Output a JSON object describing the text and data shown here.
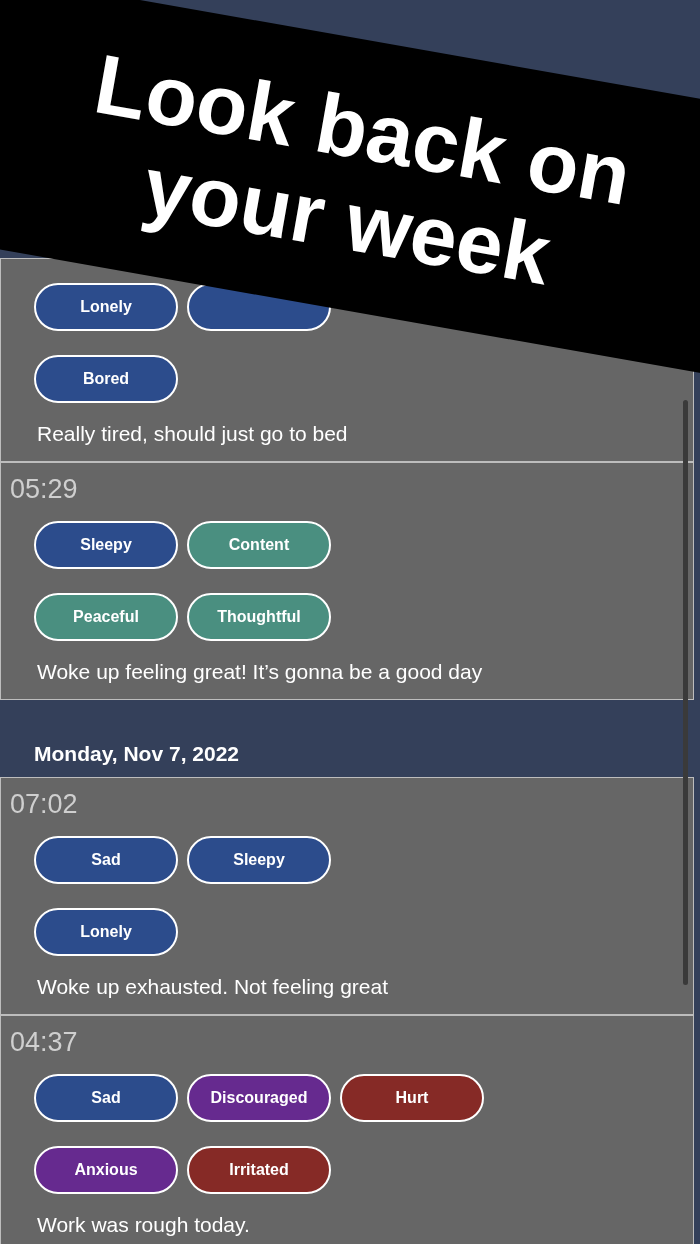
{
  "banner": {
    "title": "Look back on your week"
  },
  "entries": [
    {
      "tag_rows": [
        [
          {
            "label": "Lonely",
            "color": "#2c4c8c"
          },
          {
            "color": "#2c4c8c"
          }
        ],
        [
          {
            "label": "Bored",
            "color": "#2c4c8c"
          }
        ]
      ],
      "note": "Really tired, should just go to bed"
    },
    {
      "time": "05:29",
      "tag_rows": [
        [
          {
            "label": "Sleepy",
            "color": "#2c4c8c"
          },
          {
            "label": "Content",
            "color": "#4a8f80"
          }
        ],
        [
          {
            "label": "Peaceful",
            "color": "#4a8f80"
          },
          {
            "label": "Thoughtful",
            "color": "#4a8f80"
          }
        ]
      ],
      "note": "Woke up feeling great! It’s gonna be a good day"
    },
    {
      "date": "Monday, Nov 7, 2022",
      "time": "07:02",
      "tag_rows": [
        [
          {
            "label": "Sad",
            "color": "#2c4c8c"
          },
          {
            "label": "Sleepy",
            "color": "#2c4c8c"
          }
        ],
        [
          {
            "label": "Lonely",
            "color": "#2c4c8c"
          }
        ]
      ],
      "note": "Woke up exhausted. Not feeling great"
    },
    {
      "time": "04:37",
      "tag_rows": [
        [
          {
            "label": "Sad",
            "color": "#2c4c8c"
          },
          {
            "label": "Discouraged",
            "color": "#662a8f"
          },
          {
            "label": "Hurt",
            "color": "#862a26"
          }
        ],
        [
          {
            "label": "Anxious",
            "color": "#662a8f"
          },
          {
            "label": "Irritated",
            "color": "#862a26"
          }
        ]
      ],
      "note": "Work was rough today."
    }
  ]
}
